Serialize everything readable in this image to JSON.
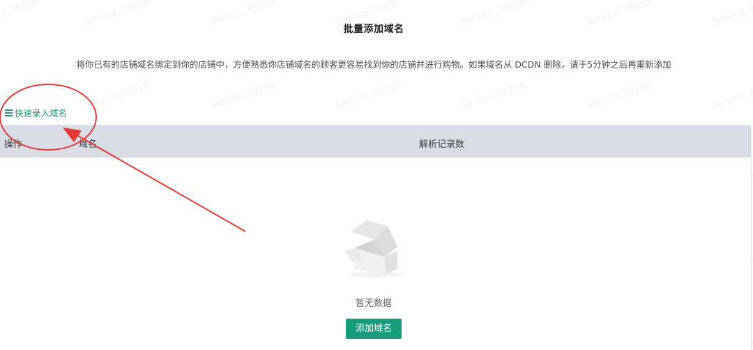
{
  "header": {
    "title": "批量添加域名",
    "description": "将你已有的店铺域名绑定到你的店铺中，方便熟悉你店铺域名的顾客更容易找到你的店铺并进行购物。如果域名从 DCDN 删除，请于5分钟之后再重新添加"
  },
  "quick_entry": {
    "label": "快速录入域名",
    "icon": "menu-icon"
  },
  "table": {
    "columns": [
      "操作",
      "域名",
      "解析记录数"
    ],
    "rows": []
  },
  "empty_state": {
    "text": "暂无数据",
    "illustration": "empty-box-icon",
    "button_label": "添加域名"
  },
  "watermark": {
    "text": "Service_35159"
  },
  "colors": {
    "accent": "#169c7b",
    "header_bg": "#d9dee6",
    "annotation": "#e53935"
  }
}
